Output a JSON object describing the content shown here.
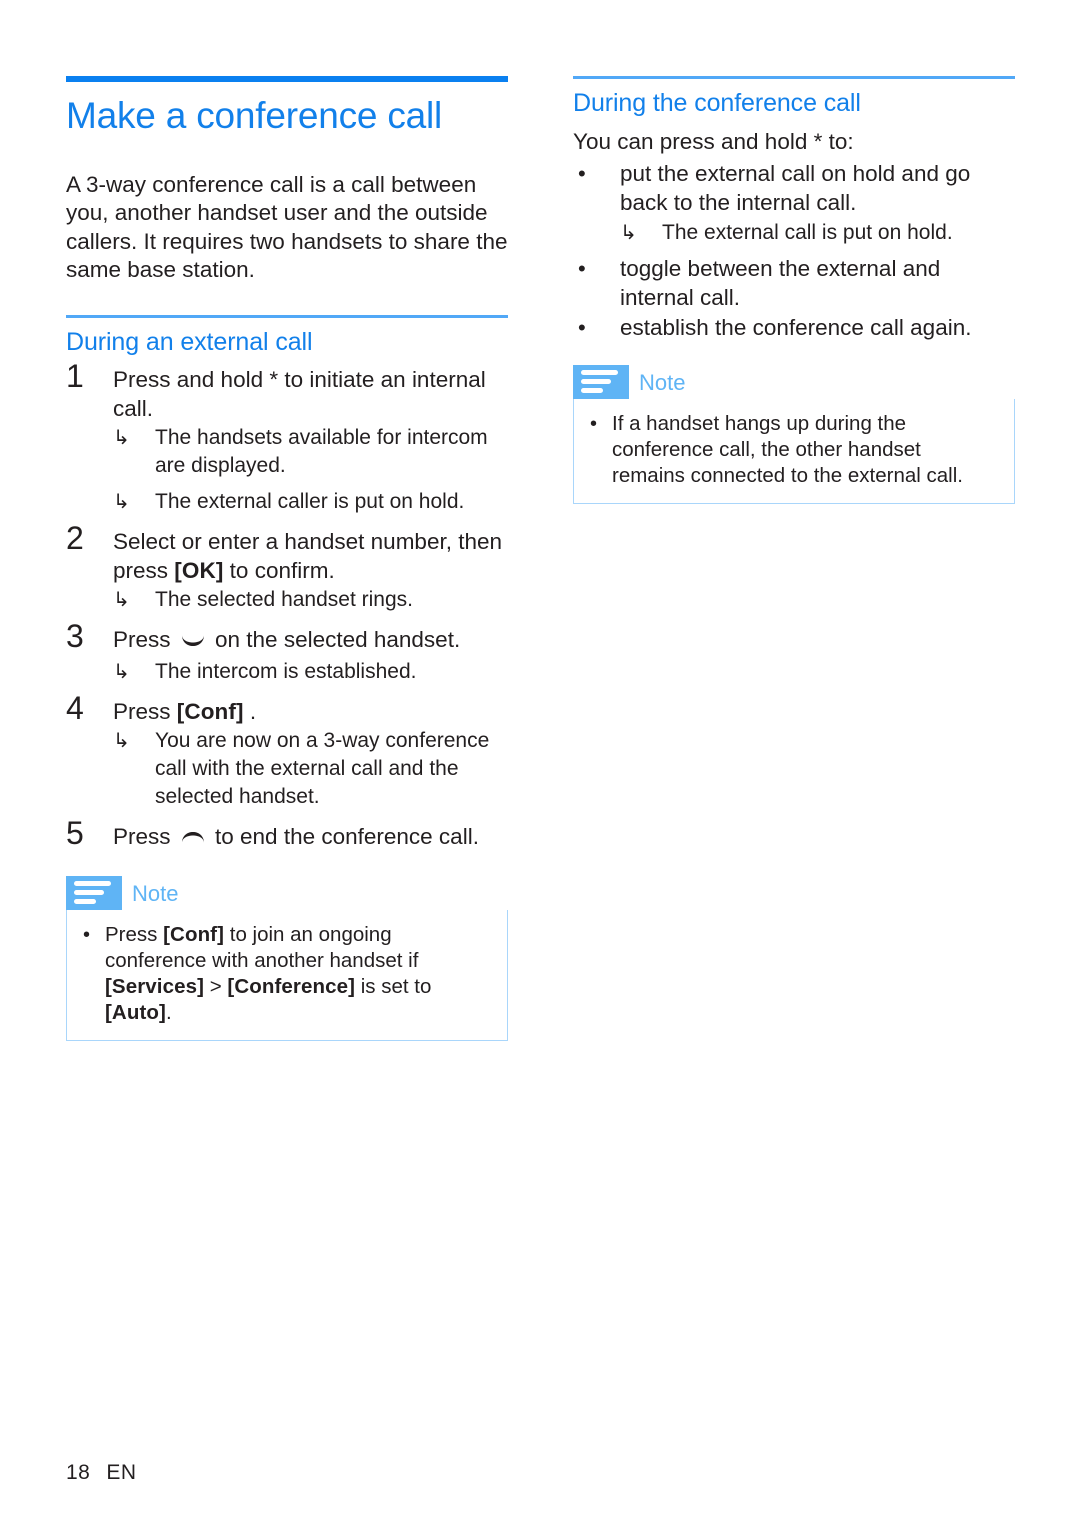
{
  "colors": {
    "heading_blue": "#1280ea",
    "rule_thick_blue": "#0a80f0",
    "rule_thin_blue": "#51a8f7",
    "note_blue": "#5fb4f5",
    "note_border": "#a9d6fb",
    "body_text": "#231f20"
  },
  "left_column": {
    "title": "Make a conference call",
    "intro": "A 3-way conference call is a call between you, another handset user and the outside callers. It requires two handsets to share the same base station.",
    "section_heading": "During an external call",
    "steps": [
      {
        "number": "1",
        "text": "Press and hold * to initiate an internal call.",
        "results": [
          "The handsets available for intercom are displayed.",
          "The external caller is put on hold."
        ]
      },
      {
        "number": "2",
        "text_before": "Select or enter a handset number, then press ",
        "ui_token": "[OK]",
        "text_after": " to confirm.",
        "results": [
          "The selected handset rings."
        ]
      },
      {
        "number": "3",
        "text_before": "Press ",
        "icon": "answer-call-icon",
        "text_after": " on the selected handset.",
        "results": [
          "The intercom is established."
        ]
      },
      {
        "number": "4",
        "text_before": "Press ",
        "ui_token": "[Conf]",
        "text_after": " .",
        "results": [
          "You are now on a 3-way conference call with the external call and the selected handset."
        ]
      },
      {
        "number": "5",
        "text_before": "Press ",
        "icon": "end-call-icon",
        "text_after": " to end the conference call.",
        "results": []
      }
    ],
    "note": {
      "icon": "note-icon",
      "label": "Note",
      "item": {
        "seg1": "Press ",
        "tok1": "[Conf]",
        "seg2": " to join an ongoing conference with another handset if ",
        "tok2": "[Services]",
        "seg3": " > ",
        "tok3": "[Conference]",
        "seg4": " is set to ",
        "tok4": "[Auto]",
        "seg5": "."
      }
    }
  },
  "right_column": {
    "section_heading": "During the conference call",
    "lead": "You can press and hold * to:",
    "bullets": [
      {
        "text": "put the external call on hold and go back to the internal call.",
        "results": [
          "The external call is put on hold."
        ]
      },
      {
        "text": "toggle between the external and internal call.",
        "results": []
      },
      {
        "text": "establish the conference call again.",
        "results": []
      }
    ],
    "note": {
      "icon": "note-icon",
      "label": "Note",
      "item_text": "If a handset hangs up during the conference call, the other handset remains connected to the external call."
    }
  },
  "footer": {
    "page_number": "18",
    "language": "EN"
  },
  "glyphs": {
    "arrow": "↳",
    "bullet": "•"
  }
}
